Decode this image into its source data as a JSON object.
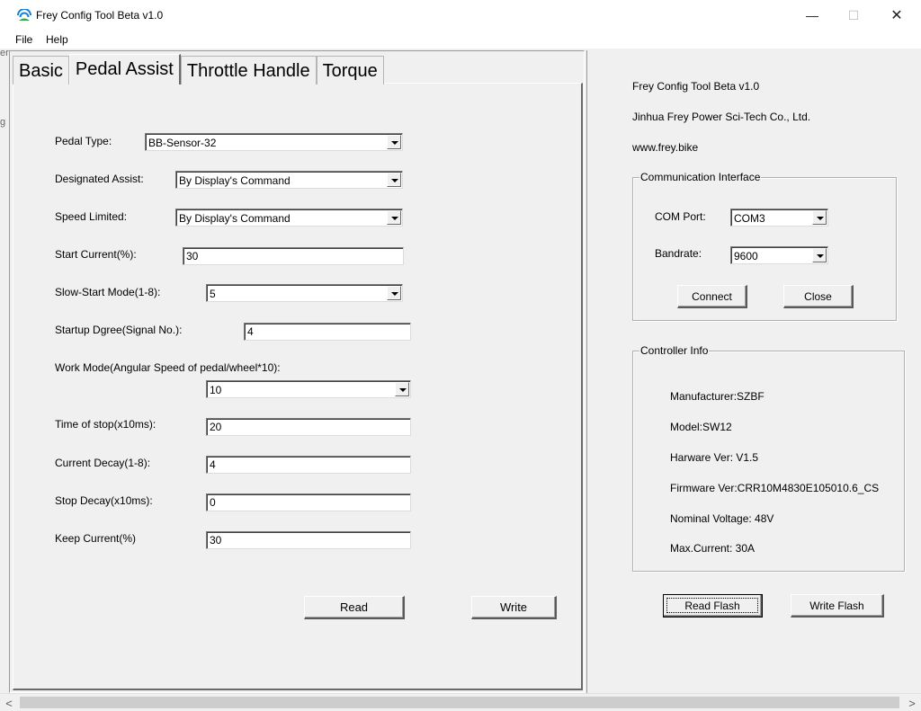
{
  "window": {
    "title": "Frey Config Tool Beta v1.0",
    "minimize_glyph": "—",
    "maximize_glyph": "☐",
    "close_glyph": "✕"
  },
  "menu": {
    "file": "File",
    "help": "Help"
  },
  "edge_fragments": {
    "top": "er",
    "mid": "g"
  },
  "tabs": [
    "Basic",
    "Pedal Assist",
    "Throttle Handle",
    "Torque"
  ],
  "pedal_assist": {
    "pedal_type": {
      "label": "Pedal Type:",
      "value": "BB-Sensor-32"
    },
    "designated_assist": {
      "label": "Designated Assist:",
      "value": "By Display's Command"
    },
    "speed_limited": {
      "label": "Speed Limited:",
      "value": "By Display's Command"
    },
    "start_current": {
      "label": "Start Current(%):",
      "value": "30"
    },
    "slow_start_mode": {
      "label": "Slow-Start Mode(1-8):",
      "value": "5"
    },
    "startup_degree": {
      "label": "Startup Dgree(Signal No.):",
      "value": "4"
    },
    "work_mode": {
      "label": "Work Mode(Angular Speed of pedal/wheel*10):",
      "value": "10"
    },
    "time_of_stop": {
      "label": "Time of stop(x10ms):",
      "value": "20"
    },
    "current_decay": {
      "label": "Current Decay(1-8):",
      "value": "4"
    },
    "stop_decay": {
      "label": "Stop Decay(x10ms):",
      "value": "0"
    },
    "keep_current": {
      "label": "Keep Current(%)",
      "value": "30"
    },
    "read_label": "Read",
    "write_label": "Write"
  },
  "info": {
    "app_name": "Frey Config Tool Beta v1.0",
    "company": "Jinhua Frey Power Sci-Tech Co., Ltd.",
    "website": "www.frey.bike"
  },
  "communication": {
    "title": "Communication Interface",
    "com_port_label": "COM Port:",
    "com_port_value": "COM3",
    "baudrate_label": "Bandrate:",
    "baudrate_value": "9600",
    "connect_label": "Connect",
    "close_label": "Close"
  },
  "controller_info": {
    "title": "Controller Info",
    "manufacturer": "Manufacturer:SZBF",
    "model": "Model:SW12",
    "hardware_ver": "Harware Ver: V1.5",
    "firmware_ver": "Firmware Ver:CRR10M4830E105010.6_CS",
    "nominal_voltage": "Nominal Voltage: 48V",
    "max_current": "Max.Current: 30A"
  },
  "flash": {
    "read_label": "Read Flash",
    "write_label": "Write Flash"
  },
  "scrollbar": {
    "left_glyph": "<",
    "right_glyph": ">"
  },
  "colors": {
    "icon_blue": "#1a7fd1",
    "icon_green": "#3aa84a",
    "panel_bg": "#f0f0f0"
  }
}
